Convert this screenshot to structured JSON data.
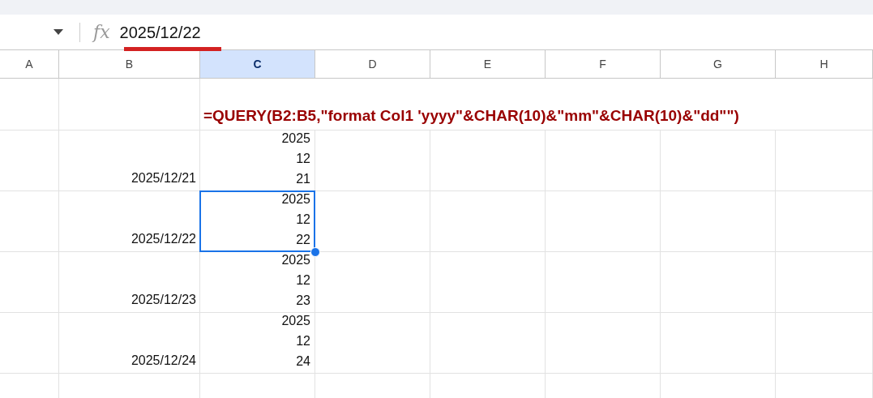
{
  "formula_bar": {
    "icon": "fx",
    "value": "2025/12/22",
    "underlined": true
  },
  "columns": [
    {
      "label": "A",
      "selected": false
    },
    {
      "label": "B",
      "selected": false
    },
    {
      "label": "C",
      "selected": true
    },
    {
      "label": "D",
      "selected": false
    },
    {
      "label": "E",
      "selected": false
    },
    {
      "label": "F",
      "selected": false
    },
    {
      "label": "G",
      "selected": false
    },
    {
      "label": "H",
      "selected": false
    }
  ],
  "formula_row": {
    "formula": "=QUERY(B2:B5,\"format Col1 'yyyy\"&CHAR(10)&\"mm\"&CHAR(10)&\"dd\"\")"
  },
  "data_rows": [
    {
      "date": "2025/12/21",
      "parts": [
        "2025",
        "12",
        "21"
      ],
      "selected": false
    },
    {
      "date": "2025/12/22",
      "parts": [
        "2025",
        "12",
        "22"
      ],
      "selected": true
    },
    {
      "date": "2025/12/23",
      "parts": [
        "2025",
        "12",
        "23"
      ],
      "selected": false
    },
    {
      "date": "2025/12/24",
      "parts": [
        "2025",
        "12",
        "24"
      ],
      "selected": false
    }
  ]
}
